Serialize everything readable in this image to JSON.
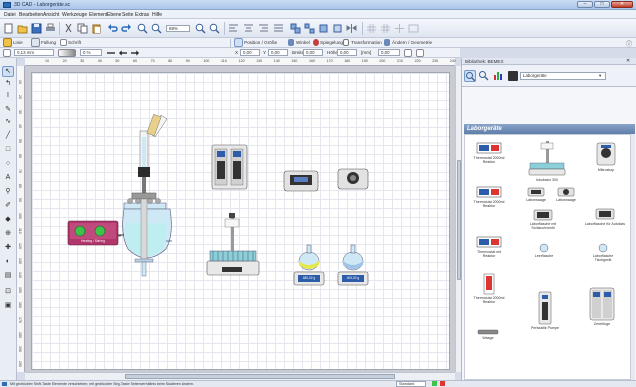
{
  "window": {
    "title": "3D CAD - Laborgeräte.sc",
    "min": "–",
    "max": "□",
    "close": "✕"
  },
  "menu": [
    "Datei",
    "Bearbeiten",
    "Ansicht",
    "Werkzeuge",
    "Element",
    "Ebene",
    "Seite",
    "Extras",
    "Hilfe"
  ],
  "toolbar": {
    "zoom_value": "88%",
    "fill_label": "Linie",
    "fill2_label": "Füllung",
    "shadow_label": "Schrift",
    "line_width": "0,13 mm",
    "opacity": "0 %"
  },
  "toolbar2": {
    "position_label": "Position / Größe",
    "rotate_label": "Winkel",
    "mirror_label": "Spiegelung",
    "transform_label": "Transformation",
    "align_label": "Ändern / Geometrie"
  },
  "toolbar3": {
    "x_label": "X",
    "x_value": "0,00",
    "y_label": "Y",
    "y_value": "0,00",
    "w_label": "Breite",
    "w_value": "0,00",
    "h_label": "Höhe",
    "h_value": "0,00",
    "unit": "[mm]",
    "angle_value": "0,00"
  },
  "ruler": {
    "h_ticks": [
      "10",
      "20",
      "30",
      "40",
      "50",
      "60",
      "70",
      "80",
      "90",
      "100",
      "110",
      "120",
      "130",
      "140",
      "150",
      "160",
      "170",
      "180",
      "190",
      "200",
      "210",
      "220",
      "230",
      "240"
    ],
    "v_ticks": [
      "10",
      "20",
      "30",
      "40",
      "50",
      "60",
      "70",
      "80",
      "90",
      "100",
      "110",
      "120",
      "130",
      "140",
      "150",
      "160",
      "170",
      "180",
      "190",
      "200"
    ]
  },
  "canvas": {
    "heater_label": "Heating / Stirring",
    "balance1_value": "480,02 g",
    "balance2_value": "400,02 g"
  },
  "library": {
    "header": "Bibliothek: BEMEX",
    "pin": "✕",
    "dropdown": "Laborgeräte",
    "category_title": "Laborgeräte",
    "items": [
      {
        "label": "Thermostat 2000ml Reaktor"
      },
      {
        "label": "Inkubator 300"
      },
      {
        "label": "Mikroskop"
      },
      {
        "label": "Thermostat 2000ml Reaktor"
      },
      {
        "label": "Laborwaage"
      },
      {
        "label": "Laborwaage"
      },
      {
        "label": "Laborflasche mit Schlauchventil"
      },
      {
        "label": "Laborflasche für Autoklav"
      },
      {
        "label": "Thermostat mit Reaktor"
      },
      {
        "label": "Leerflasche"
      },
      {
        "label": "Laborflasche Tischgerät"
      },
      {
        "label": "Thermostat 2000ml Reaktor"
      },
      {
        "label": "Waage"
      },
      {
        "label": "Peristaltik Pumpe"
      },
      {
        "label": "Zentrifuge"
      }
    ]
  },
  "status": {
    "hint": "Mit gedrückter Shift-Taste Elemente verschieben; mit gedrückter Strg-Taste Seitenverhältnis beim Skalieren ändern.",
    "page_select": "Standard"
  },
  "colors": {
    "accent": "#2c6db8",
    "lib_title": "#5f7ea9",
    "heater": "#b0356b",
    "glass": "#cfe8f5",
    "liquid": "#bfeef0"
  }
}
